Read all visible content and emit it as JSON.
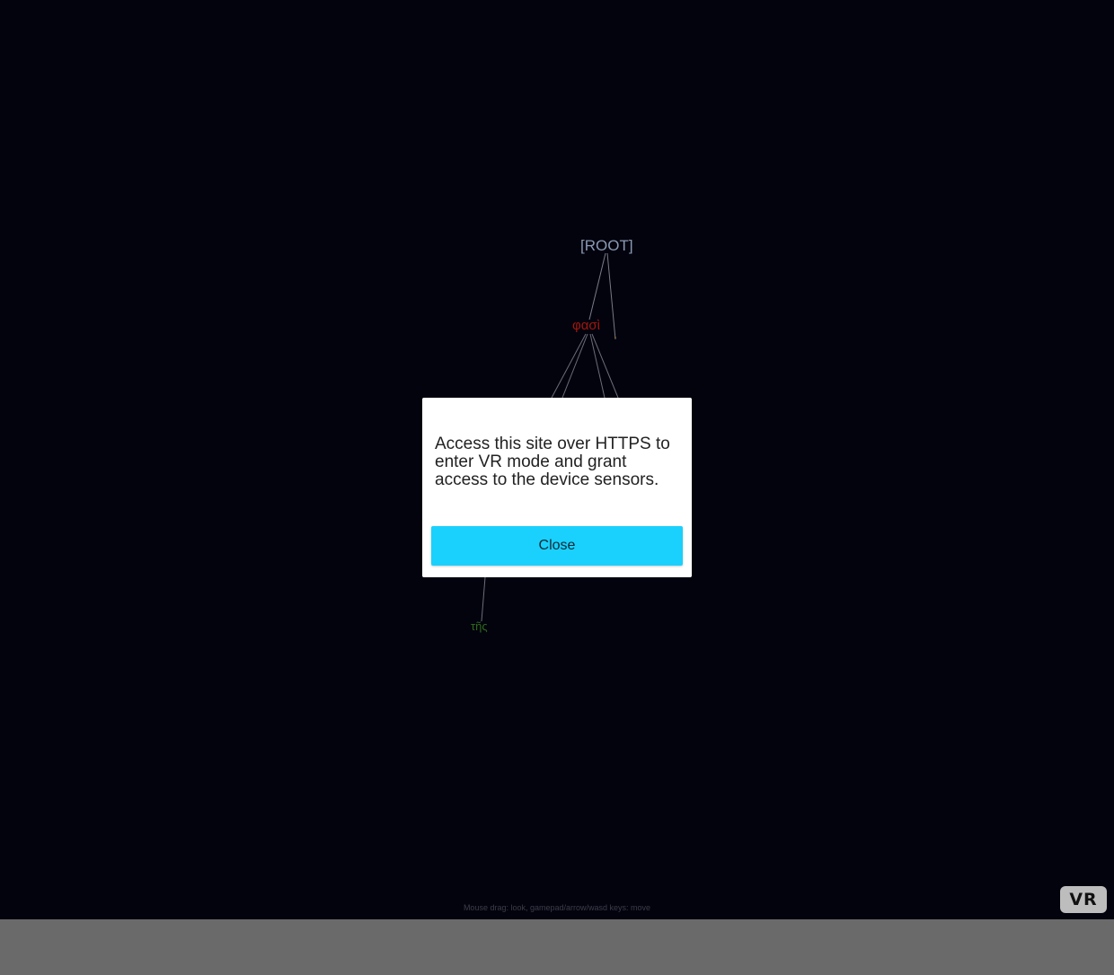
{
  "scene": {
    "nodes": {
      "root": "[ROOT]",
      "phasi": "φασὶ",
      "dot": "·",
      "tes": "τῆς"
    },
    "hint": "Mouse drag: look, gamepad/arrow/wasd keys: move",
    "colors": {
      "background": "#03030e",
      "root_label": "#8a9ab4",
      "phasi_label": "#a0180e",
      "tes_label": "#2f6a1a",
      "edges": "#9a9aa8"
    }
  },
  "vr_button": {
    "label": "VR"
  },
  "modal": {
    "message": "Access this site over HTTPS to enter VR mode and grant access to the device sensors.",
    "close_label": "Close",
    "button_color": "#1ad1fd"
  }
}
